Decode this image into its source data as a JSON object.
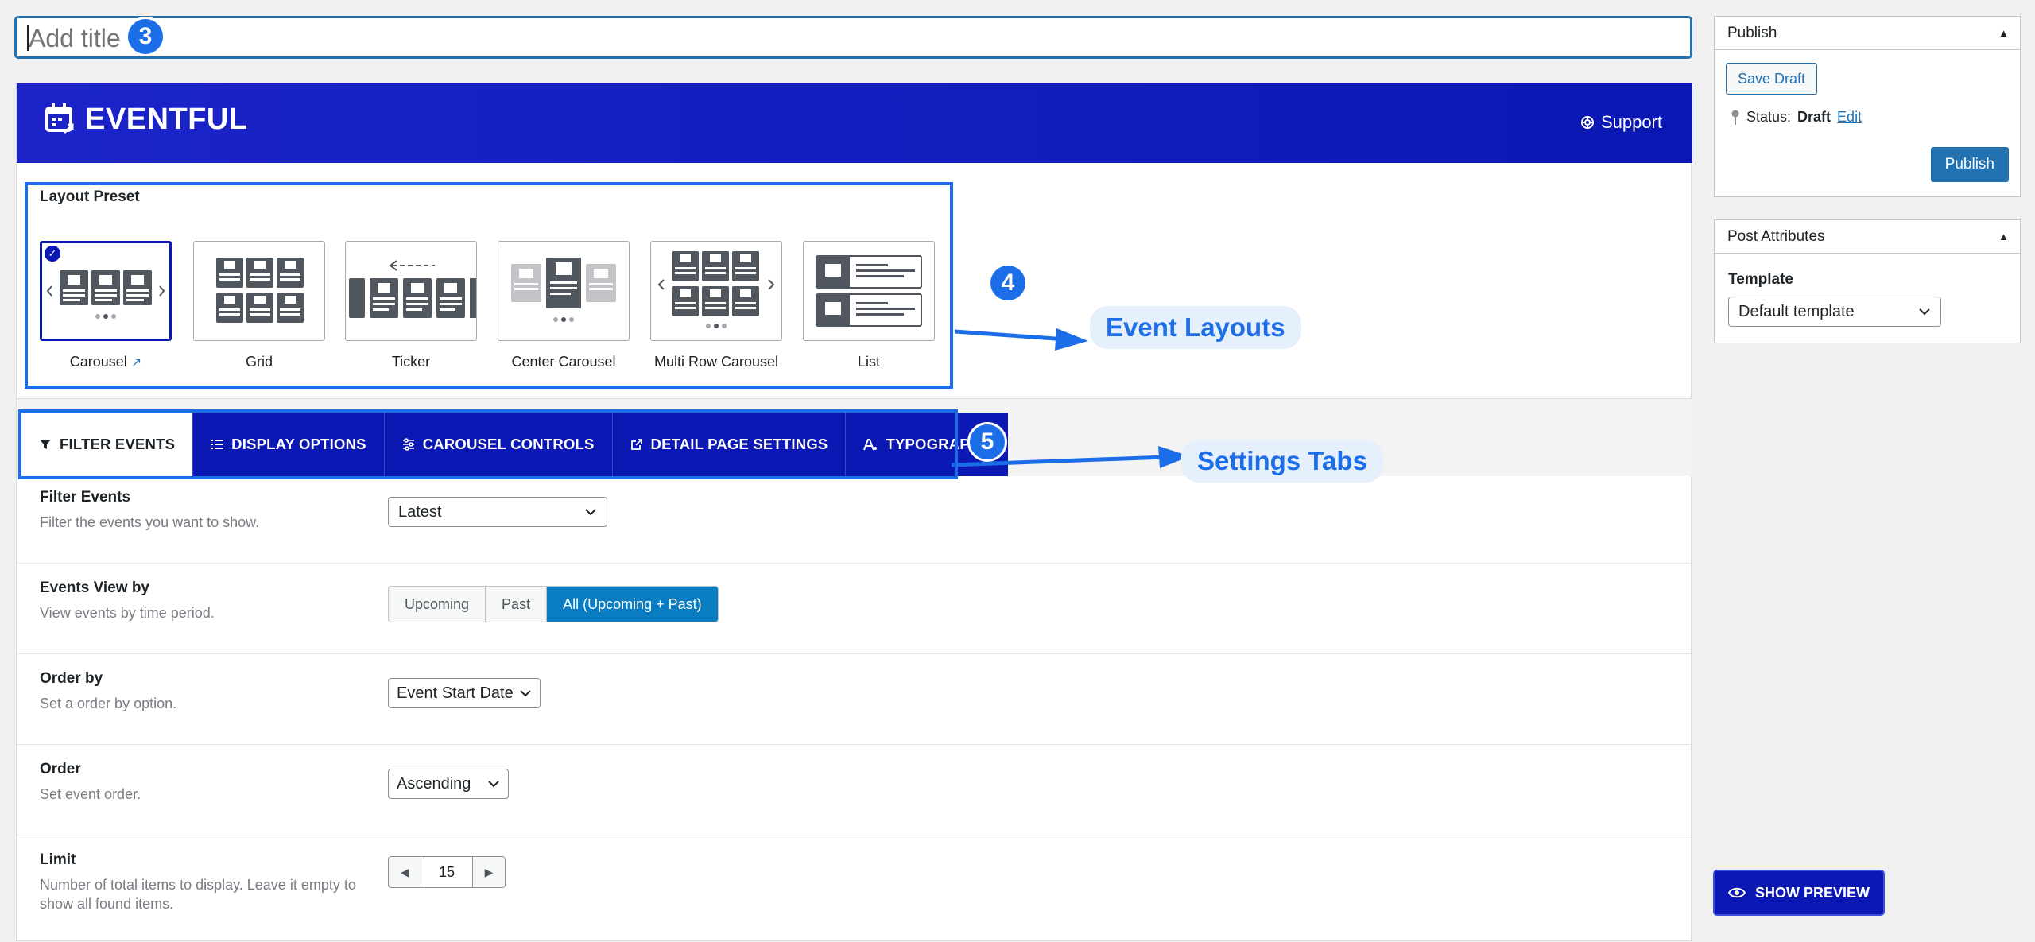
{
  "title_field": {
    "placeholder": "Add title",
    "badge": "3"
  },
  "header": {
    "brand": "EVENTFUL",
    "support_label": "Support"
  },
  "layout_preset": {
    "heading": "Layout Preset",
    "badge": "4",
    "callout": "Event Layouts",
    "items": [
      {
        "label": "Carousel",
        "selected": true,
        "icon": "carousel-preset-icon"
      },
      {
        "label": "Grid",
        "selected": false,
        "icon": "grid-preset-icon"
      },
      {
        "label": "Ticker",
        "selected": false,
        "icon": "ticker-preset-icon"
      },
      {
        "label": "Center Carousel",
        "selected": false,
        "icon": "center-carousel-preset-icon"
      },
      {
        "label": "Multi Row Carousel",
        "selected": false,
        "icon": "multi-row-carousel-preset-icon"
      },
      {
        "label": "List",
        "selected": false,
        "icon": "list-preset-icon"
      }
    ]
  },
  "tabs": {
    "badge": "5",
    "callout": "Settings Tabs",
    "items": [
      {
        "label": "FILTER EVENTS",
        "icon": "filter-icon",
        "active": true
      },
      {
        "label": "DISPLAY OPTIONS",
        "icon": "list-icon",
        "active": false
      },
      {
        "label": "CAROUSEL CONTROLS",
        "icon": "sliders-icon",
        "active": false
      },
      {
        "label": "DETAIL PAGE SETTINGS",
        "icon": "external-link-icon",
        "active": false
      },
      {
        "label": "TYPOGRAPHY",
        "icon": "typography-icon",
        "active": false
      }
    ]
  },
  "settings": {
    "filter_events": {
      "title": "Filter Events",
      "desc": "Filter the events you want to show.",
      "value": "Latest"
    },
    "events_view_by": {
      "title": "Events View by",
      "desc": "View events by time period.",
      "options": [
        "Upcoming",
        "Past",
        "All (Upcoming + Past)"
      ],
      "selected": "All (Upcoming + Past)"
    },
    "order_by": {
      "title": "Order by",
      "desc": "Set a order by option.",
      "value": "Event Start Date"
    },
    "order": {
      "title": "Order",
      "desc": "Set event order.",
      "value": "Ascending"
    },
    "limit": {
      "title": "Limit",
      "desc": "Number of total items to display. Leave it empty to show all found items.",
      "value": "15"
    }
  },
  "sidebar": {
    "publish": {
      "title": "Publish",
      "save_draft": "Save Draft",
      "status_label": "Status:",
      "status_value": "Draft",
      "edit_link": "Edit",
      "publish_button": "Publish"
    },
    "post_attributes": {
      "title": "Post Attributes",
      "template_label": "Template",
      "template_value": "Default template"
    }
  },
  "show_preview": "SHOW PREVIEW",
  "colors": {
    "brand_blue": "#0b18b3",
    "annotation_blue": "#1c6ee8",
    "wp_blue": "#2271b1",
    "segment_active": "#0a7cc1"
  }
}
